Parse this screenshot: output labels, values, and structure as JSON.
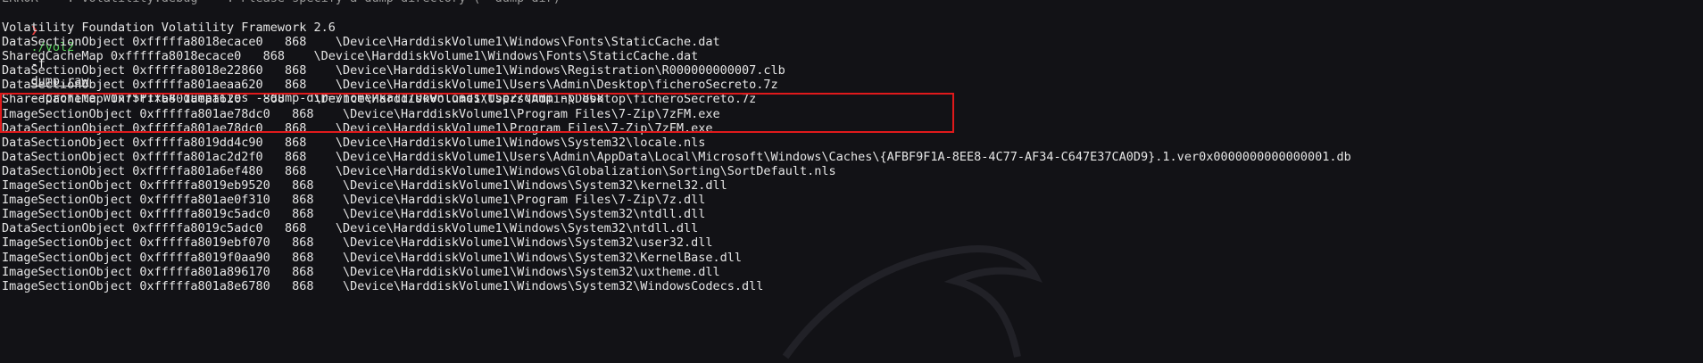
{
  "terminal": {
    "top_partial_line": "ERROR    : volatility.debug    : Please specify a dump directory (--dump-dir)",
    "prompt_symbol": "❯",
    "command": {
      "exe": "./vol2",
      "flag_f": "-f",
      "file": "dump.raw",
      "rest": "--profile Win7SP1x64 dumpfiles --dump-dir=/home/kali/Downloads/t5p2/dump -p 868"
    },
    "banner": "Volatility Foundation Volatility Framework 2.6",
    "lines": [
      "DataSectionObject 0xfffffa8018ecace0   868    \\Device\\HarddiskVolume1\\Windows\\Fonts\\StaticCache.dat",
      "SharedCacheMap 0xfffffa8018ecace0   868    \\Device\\HarddiskVolume1\\Windows\\Fonts\\StaticCache.dat",
      "DataSectionObject 0xfffffa8018e22860   868    \\Device\\HarddiskVolume1\\Windows\\Registration\\R000000000007.clb",
      "DataSectionObject 0xfffffa801aeaa620   868    \\Device\\HarddiskVolume1\\Users\\Admin\\Desktop\\ficheroSecreto.7z",
      "SharedCacheMap 0xfffffa801aeaa620   868    \\Device\\HarddiskVolume1\\Users\\Admin\\Desktop\\ficheroSecreto.7z",
      "ImageSectionObject 0xfffffa801ae78dc0   868    \\Device\\HarddiskVolume1\\Program Files\\7-Zip\\7zFM.exe",
      "DataSectionObject 0xfffffa801ae78dc0   868    \\Device\\HarddiskVolume1\\Program Files\\7-Zip\\7zFM.exe",
      "DataSectionObject 0xfffffa8019dd4c90   868    \\Device\\HarddiskVolume1\\Windows\\System32\\locale.nls",
      "DataSectionObject 0xfffffa801ac2d2f0   868    \\Device\\HarddiskVolume1\\Users\\Admin\\AppData\\Local\\Microsoft\\Windows\\Caches\\{AFBF9F1A-8EE8-4C77-AF34-C647E37CA0D9}.1.ver0x0000000000000001.db",
      "DataSectionObject 0xfffffa801a6ef480   868    \\Device\\HarddiskVolume1\\Windows\\Globalization\\Sorting\\SortDefault.nls",
      "ImageSectionObject 0xfffffa8019eb9520   868    \\Device\\HarddiskVolume1\\Windows\\System32\\kernel32.dll",
      "ImageSectionObject 0xfffffa801ae0f310   868    \\Device\\HarddiskVolume1\\Program Files\\7-Zip\\7z.dll",
      "ImageSectionObject 0xfffffa8019c5adc0   868    \\Device\\HarddiskVolume1\\Windows\\System32\\ntdll.dll",
      "DataSectionObject 0xfffffa8019c5adc0   868    \\Device\\HarddiskVolume1\\Windows\\System32\\ntdll.dll",
      "ImageSectionObject 0xfffffa8019ebf070   868    \\Device\\HarddiskVolume1\\Windows\\System32\\user32.dll",
      "ImageSectionObject 0xfffffa8019f0aa90   868    \\Device\\HarddiskVolume1\\Windows\\System32\\KernelBase.dll",
      "ImageSectionObject 0xfffffa801a896170   868    \\Device\\HarddiskVolume1\\Windows\\System32\\uxtheme.dll",
      "ImageSectionObject 0xfffffa801a8e6780   868    \\Device\\HarddiskVolume1\\Windows\\System32\\WindowsCodecs.dll"
    ],
    "colors": {
      "background": "#121216",
      "text": "#e6e6e6",
      "prompt": "#e03c3c",
      "command": "#56d05a",
      "highlight_border": "#e0191b"
    }
  }
}
